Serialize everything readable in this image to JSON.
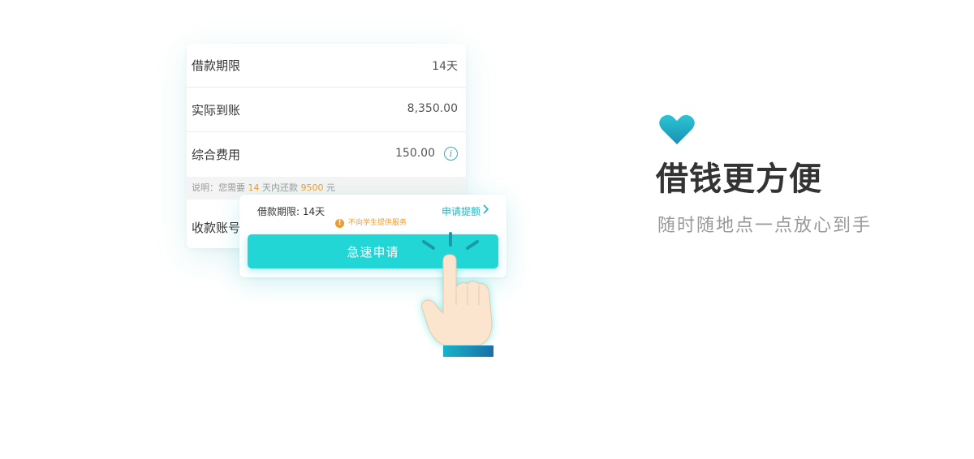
{
  "loan_card": {
    "rows": [
      {
        "label": "借款期限",
        "value": "14天"
      },
      {
        "label": "实际到账",
        "value": "8,350.00"
      },
      {
        "label": "综合费用",
        "value": "150.00"
      }
    ],
    "note": {
      "prefix": "说明：您需要",
      "days": "14",
      "middle": "天内还款",
      "amount": "9500",
      "suffix": "元"
    },
    "account_label": "收款账号"
  },
  "popup": {
    "term": "借款期限: 14天",
    "link": "申请提额",
    "warning": "不向学生提供服务",
    "button": "急速申请"
  },
  "promo": {
    "title": "借钱更方便",
    "subtitle": "随时随地点一点放心到手"
  },
  "colors": {
    "accent": "#22d6d6",
    "link": "#1fb7c8",
    "highlight": "#f29b2a",
    "heart_top": "#2bc6d4",
    "heart_bottom": "#1a8fb5"
  },
  "icons": [
    "info-icon",
    "chevron-right-icon",
    "warning-icon",
    "hand-pointer-icon",
    "heart-icon"
  ]
}
